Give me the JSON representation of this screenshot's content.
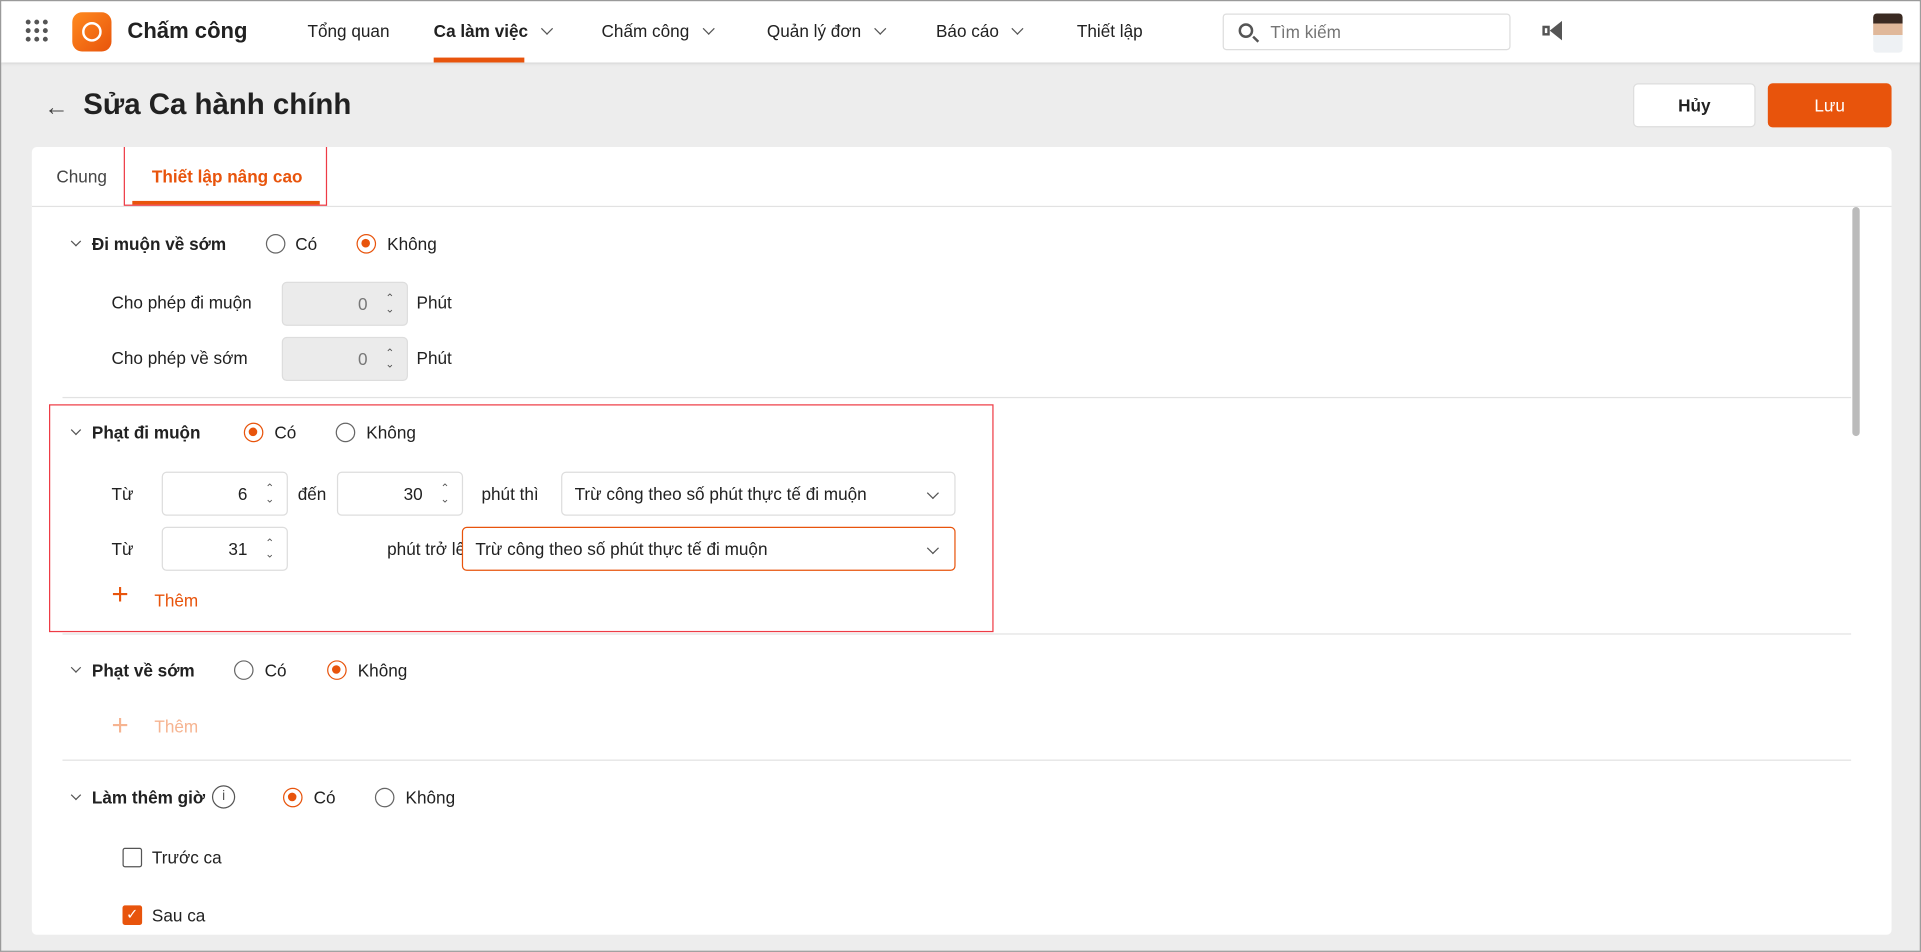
{
  "app": {
    "name": "Chấm công"
  },
  "nav": [
    {
      "label": "Tổng quan"
    },
    {
      "label": "Ca làm việc"
    },
    {
      "label": "Chấm công"
    },
    {
      "label": "Quản lý đơn"
    },
    {
      "label": "Báo cáo"
    },
    {
      "label": "Thiết lập"
    }
  ],
  "search": {
    "placeholder": "Tìm kiếm"
  },
  "page": {
    "title": "Sửa Ca hành chính",
    "cancel": "Hủy",
    "save": "Lưu"
  },
  "tabs": [
    {
      "label": "Chung"
    },
    {
      "label": "Thiết lập nâng cao"
    }
  ],
  "late_early": {
    "title": "Đi muộn về sớm",
    "yes": "Có",
    "no": "Không",
    "selected": "Không",
    "allow_late": {
      "label": "Cho phép đi muộn",
      "value": "0",
      "unit": "Phút"
    },
    "allow_early": {
      "label": "Cho phép về sớm",
      "value": "0",
      "unit": "Phút"
    }
  },
  "late_penalty": {
    "title": "Phạt đi muộn",
    "yes": "Có",
    "no": "Không",
    "selected": "Có",
    "rows": [
      {
        "from_label": "Từ",
        "from": "6",
        "to_label": "đến",
        "to": "30",
        "then_label": "phút thì",
        "action": "Trừ công theo số phút thực tế đi muộn"
      },
      {
        "from_label": "Từ",
        "from": "31",
        "then_label": "phút trở lên thì",
        "action": "Trừ công theo số phút thực tế đi muộn"
      }
    ],
    "add": "Thêm"
  },
  "early_penalty": {
    "title": "Phạt về sớm",
    "yes": "Có",
    "no": "Không",
    "selected": "Không",
    "add": "Thêm"
  },
  "overtime": {
    "title": "Làm thêm giờ",
    "yes": "Có",
    "no": "Không",
    "selected": "Có",
    "before": {
      "label": "Trước ca",
      "checked": false
    },
    "after": {
      "label": "Sau ca",
      "checked": true
    }
  },
  "colors": {
    "accent": "#e8540c",
    "highlight": "#ee3b45"
  }
}
